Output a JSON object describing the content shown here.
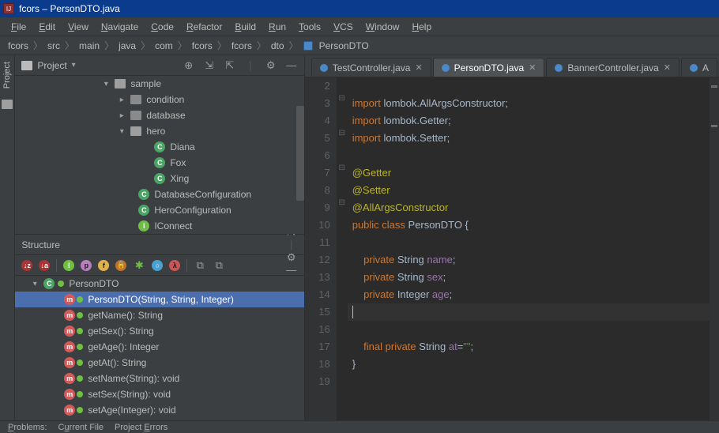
{
  "window": {
    "title": "fcors – PersonDTO.java"
  },
  "menu": [
    "File",
    "Edit",
    "View",
    "Navigate",
    "Code",
    "Refactor",
    "Build",
    "Run",
    "Tools",
    "VCS",
    "Window",
    "Help"
  ],
  "breadcrumb": [
    "fcors",
    "src",
    "main",
    "java",
    "com",
    "fcors",
    "fcors",
    "dto",
    "PersonDTO"
  ],
  "project_panel": {
    "title": "Project",
    "tree": [
      {
        "indent": 110,
        "caret": "down",
        "fico": "folder-open",
        "label": "sample"
      },
      {
        "indent": 130,
        "caret": "right",
        "fico": "folder",
        "label": "condition"
      },
      {
        "indent": 130,
        "caret": "right",
        "fico": "folder",
        "label": "database"
      },
      {
        "indent": 130,
        "caret": "down",
        "fico": "folder-open",
        "label": "hero"
      },
      {
        "indent": 160,
        "caret": "",
        "circ": "c",
        "clabel": "C",
        "label": "Diana"
      },
      {
        "indent": 160,
        "caret": "",
        "circ": "c",
        "clabel": "C",
        "label": "Fox"
      },
      {
        "indent": 160,
        "caret": "",
        "circ": "c",
        "clabel": "C",
        "label": "Xing"
      },
      {
        "indent": 140,
        "caret": "",
        "circ": "c",
        "clabel": "C",
        "label": "DatabaseConfiguration"
      },
      {
        "indent": 140,
        "caret": "",
        "circ": "c",
        "clabel": "C",
        "label": "HeroConfiguration"
      },
      {
        "indent": 140,
        "caret": "",
        "circ": "i",
        "clabel": "I",
        "label": "IConnect"
      }
    ]
  },
  "structure_panel": {
    "title": "Structure",
    "root": "PersonDTO",
    "items": [
      {
        "icon": "m",
        "label": "PersonDTO(String, String, Integer)",
        "sel": true
      },
      {
        "icon": "m",
        "label": "getName(): String"
      },
      {
        "icon": "m",
        "label": "getSex(): String"
      },
      {
        "icon": "m",
        "label": "getAge(): Integer"
      },
      {
        "icon": "m",
        "label": "getAt(): String"
      },
      {
        "icon": "m",
        "label": "setName(String): void"
      },
      {
        "icon": "m",
        "label": "setSex(String): void"
      },
      {
        "icon": "m",
        "label": "setAge(Integer): void"
      }
    ]
  },
  "tabs": [
    {
      "label": "TestController.java",
      "active": false
    },
    {
      "label": "PersonDTO.java",
      "active": true
    },
    {
      "label": "BannerController.java",
      "active": false
    },
    {
      "label": "A",
      "active": false,
      "partial": true
    }
  ],
  "editor": {
    "lines": [
      {
        "n": 2,
        "html": ""
      },
      {
        "n": 3,
        "html": "<span class='k-key'>import</span> lombok.<span class='k-imp'>AllArgsConstructor</span>;"
      },
      {
        "n": 4,
        "html": "<span class='k-key'>import</span> lombok.<span class='k-imp'>Getter</span>;"
      },
      {
        "n": 5,
        "html": "<span class='k-key'>import</span> lombok.<span class='k-imp'>Setter</span>;"
      },
      {
        "n": 6,
        "html": ""
      },
      {
        "n": 7,
        "html": "<span class='k-ann'>@Getter</span>"
      },
      {
        "n": 8,
        "html": "<span class='k-ann'>@Setter</span>"
      },
      {
        "n": 9,
        "html": "<span class='k-ann'>@AllArgsConstructor</span>"
      },
      {
        "n": 10,
        "html": "<span class='k-key'>public class</span> PersonDTO {"
      },
      {
        "n": 11,
        "html": ""
      },
      {
        "n": 12,
        "html": "    <span class='k-key'>private</span> String <span class='k-field'>name</span>;"
      },
      {
        "n": 13,
        "html": "    <span class='k-key'>private</span> String <span class='k-field'>sex</span>;"
      },
      {
        "n": 14,
        "html": "    <span class='k-key'>private</span> Integer <span class='k-field'>age</span>;"
      },
      {
        "n": 15,
        "html": "",
        "current": true
      },
      {
        "n": 16,
        "html": ""
      },
      {
        "n": 17,
        "html": "    <span class='k-key'>final private</span> String <span class='k-field'>at</span>=<span class='k-str'>\"\"</span>;"
      },
      {
        "n": 18,
        "html": "}"
      },
      {
        "n": 19,
        "html": ""
      }
    ]
  },
  "bottom_tabs": [
    "Problems:",
    "Current File",
    "Project Errors"
  ]
}
